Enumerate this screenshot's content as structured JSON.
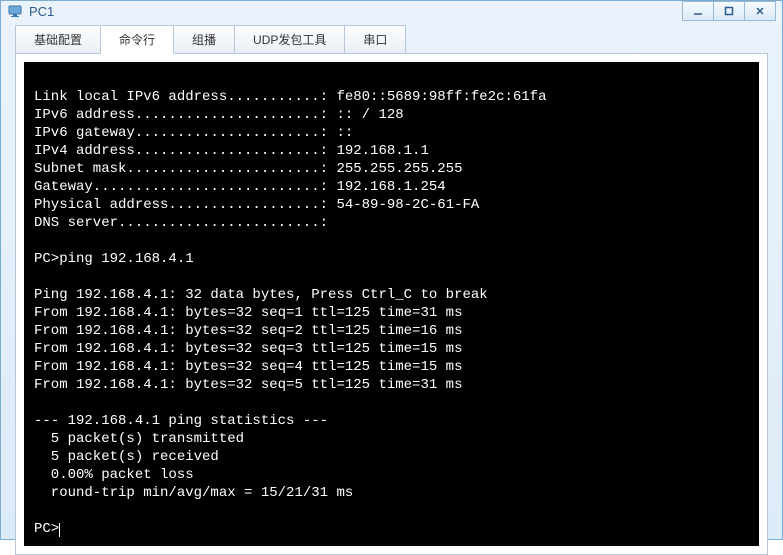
{
  "window": {
    "title": "PC1"
  },
  "tabs": [
    {
      "label": "基础配置",
      "active": false
    },
    {
      "label": "命令行",
      "active": true
    },
    {
      "label": "组播",
      "active": false
    },
    {
      "label": "UDP发包工具",
      "active": false
    },
    {
      "label": "串口",
      "active": false
    }
  ],
  "terminal": {
    "lines": [
      "",
      "Link local IPv6 address...........: fe80::5689:98ff:fe2c:61fa",
      "IPv6 address......................: :: / 128",
      "IPv6 gateway......................: ::",
      "IPv4 address......................: 192.168.1.1",
      "Subnet mask.......................: 255.255.255.255",
      "Gateway...........................: 192.168.1.254",
      "Physical address..................: 54-89-98-2C-61-FA",
      "DNS server........................:",
      "",
      "PC>ping 192.168.4.1",
      "",
      "Ping 192.168.4.1: 32 data bytes, Press Ctrl_C to break",
      "From 192.168.4.1: bytes=32 seq=1 ttl=125 time=31 ms",
      "From 192.168.4.1: bytes=32 seq=2 ttl=125 time=16 ms",
      "From 192.168.4.1: bytes=32 seq=3 ttl=125 time=15 ms",
      "From 192.168.4.1: bytes=32 seq=4 ttl=125 time=15 ms",
      "From 192.168.4.1: bytes=32 seq=5 ttl=125 time=31 ms",
      "",
      "--- 192.168.4.1 ping statistics ---",
      "  5 packet(s) transmitted",
      "  5 packet(s) received",
      "  0.00% packet loss",
      "  round-trip min/avg/max = 15/21/31 ms",
      ""
    ],
    "prompt": "PC>"
  }
}
